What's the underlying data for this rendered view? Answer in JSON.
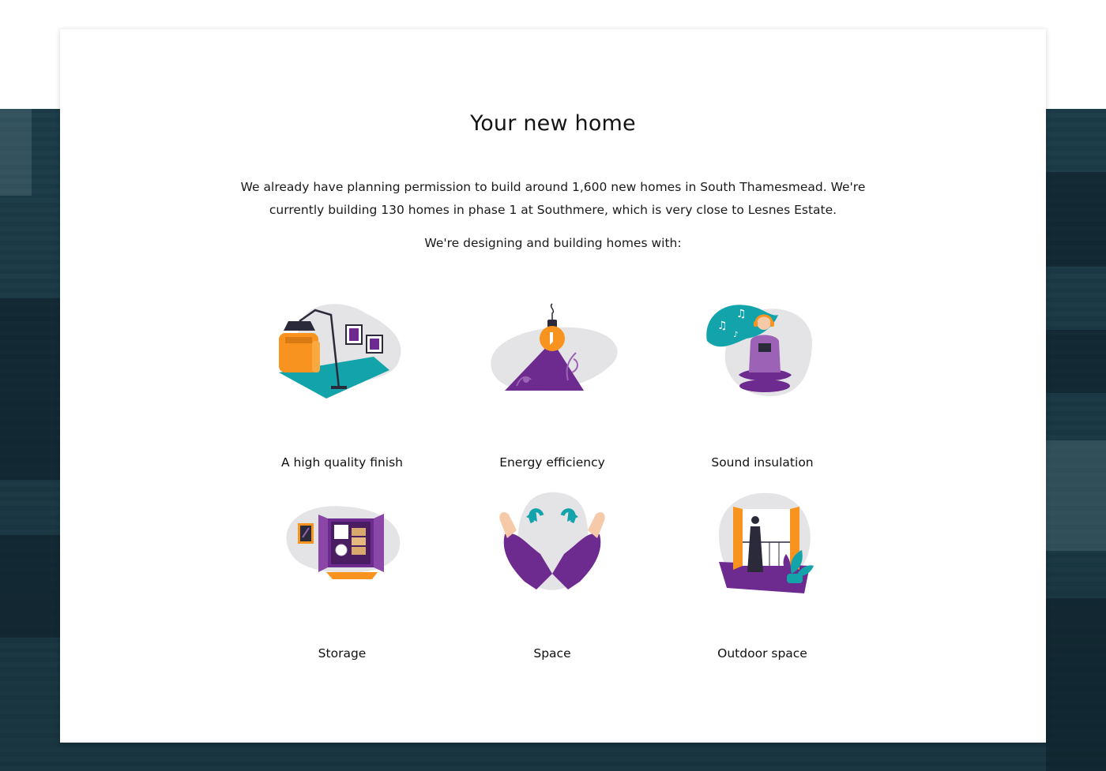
{
  "section": {
    "title": "Your new home",
    "intro": "We already have planning permission to build around 1,600 new homes in South Thamesmead. We're currently building 130 homes in phase 1 at Southmere, which is very close to Lesnes Estate.",
    "subhead": "We're designing and building homes with:"
  },
  "features": [
    {
      "label": "A high quality finish",
      "icon": "armchair-lamp-icon"
    },
    {
      "label": "Energy efficiency",
      "icon": "lightbulb-icon"
    },
    {
      "label": "Sound insulation",
      "icon": "meditation-headphones-icon"
    },
    {
      "label": "Storage",
      "icon": "cupboard-icon"
    },
    {
      "label": "Space",
      "icon": "hands-arrows-icon"
    },
    {
      "label": "Outdoor space",
      "icon": "balcony-icon"
    }
  ],
  "colors": {
    "teal": "#13a3ab",
    "purple": "#6e2b8f",
    "orange": "#f7931e",
    "blob": "#e4e4e6",
    "skin": "#f6c9a8",
    "dark": "#2a2a3a"
  }
}
